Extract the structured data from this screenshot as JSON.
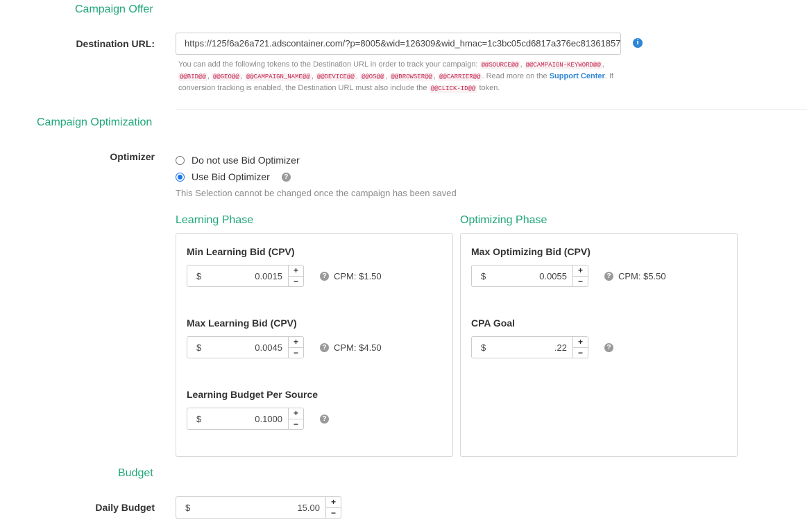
{
  "campaign_offer": {
    "title": "Campaign Offer",
    "destination_label": "Destination URL:",
    "destination_value": "https://125f6a26a721.adscontainer.com/?p=8005&wid=126309&wid_hmac=1c3bc05cd6817a376ec81361857",
    "info_icon": "i",
    "help_intro": "You can add the following tokens to the Destination URL in order to track your campaign:",
    "tokens": [
      "@@SOURCE@@",
      "@@CAMPAIGN-KEYWORD@@",
      "@@BID@@",
      "@@GEO@@",
      "@@CAMPAIGN_NAME@@",
      "@@DEVICE@@",
      "@@OS@@",
      "@@BROWSER@@",
      "@@CARRIER@@"
    ],
    "help_read_more": ". Read more on the",
    "support_link": "Support Center",
    "help_conversion": ". If conversion tracking is enabled, the Destination URL must also include the",
    "click_token": "@@CLICK-ID@@",
    "help_end": "token."
  },
  "optimization": {
    "title": "Campaign Optimization",
    "optimizer_label": "Optimizer",
    "option_no": "Do not use Bid Optimizer",
    "option_yes": "Use Bid Optimizer",
    "selected": "Use Bid Optimizer",
    "note": "This Selection cannot be changed once the campaign has been saved",
    "help_glyph": "?"
  },
  "learning": {
    "title": "Learning Phase",
    "min_label": "Min Learning Bid (CPV)",
    "min_currency": "$",
    "min_value": "0.0015",
    "min_cpm": "CPM: $1.50",
    "max_label": "Max Learning Bid (CPV)",
    "max_currency": "$",
    "max_value": "0.0045",
    "max_cpm": "CPM: $4.50",
    "budget_label": "Learning Budget Per Source",
    "budget_currency": "$",
    "budget_value": "0.1000"
  },
  "optimizing": {
    "title": "Optimizing Phase",
    "max_label": "Max Optimizing Bid (CPV)",
    "max_currency": "$",
    "max_value": "0.0055",
    "max_cpm": "CPM: $5.50",
    "cpa_label": "CPA Goal",
    "cpa_currency": "$",
    "cpa_value": ".22"
  },
  "budget": {
    "title": "Budget",
    "daily_label": "Daily Budget",
    "daily_currency": "$",
    "daily_value": "15.00"
  },
  "stepper": {
    "plus": "+",
    "minus": "−"
  },
  "colors": {
    "accent": "#1fa67a",
    "link": "#2f86d6",
    "token": "#c7254e",
    "radio": "#1a73e8"
  }
}
